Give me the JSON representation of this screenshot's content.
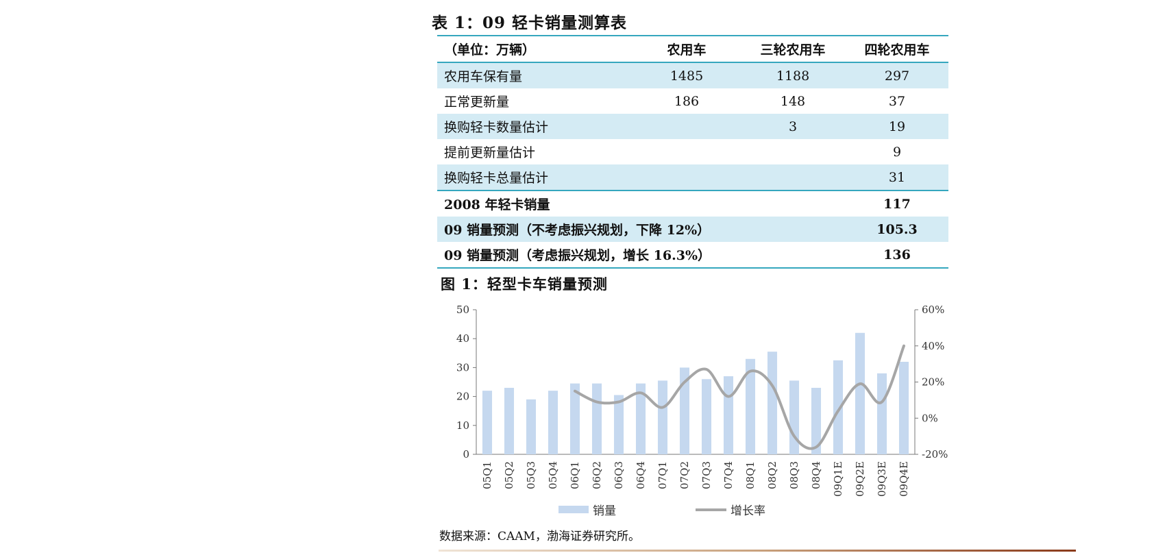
{
  "table": {
    "title": "表 1：09 轻卡销量测算表",
    "header": [
      "（单位：万辆）",
      "农用车",
      "三轮农用车",
      "四轮农用车"
    ],
    "rows": [
      {
        "label": "农用车保有量",
        "cells": [
          "1485",
          "1188",
          "297"
        ]
      },
      {
        "label": "正常更新量",
        "cells": [
          "186",
          "148",
          "37"
        ]
      },
      {
        "label": "换购轻卡数量估计",
        "cells": [
          "",
          "3",
          "19"
        ]
      },
      {
        "label": "提前更新量估计",
        "cells": [
          "",
          "",
          "9"
        ]
      },
      {
        "label": "换购轻卡总量估计",
        "cells": [
          "",
          "",
          "31"
        ]
      },
      {
        "label": "2008 年轻卡销量",
        "cells": [
          "",
          "",
          "117"
        ]
      },
      {
        "label": "09 销量预测（不考虑振兴规划，下降 12%）",
        "cells": [
          "",
          "",
          "105.3"
        ]
      },
      {
        "label": "09 销量预测（考虑振兴规划，增长 16.3%）",
        "cells": [
          "",
          "",
          "136"
        ]
      }
    ]
  },
  "figure": {
    "title": "图 1：轻型卡车销量预测",
    "source": "数据来源：CAAM，渤海证券研究所。"
  },
  "colors": {
    "rule": "#35a7be",
    "row_shade": "#d4ebf4",
    "bar": "#c5d8ef",
    "line": "#a6a6a6",
    "axis": "#777777"
  },
  "chart_data": {
    "type": "bar",
    "title": "",
    "categories": [
      "05Q1",
      "05Q2",
      "05Q3",
      "05Q4",
      "06Q1",
      "06Q2",
      "06Q3",
      "06Q4",
      "07Q1",
      "07Q2",
      "07Q3",
      "07Q4",
      "08Q1",
      "08Q2",
      "08Q3",
      "08Q4",
      "09Q1E",
      "09Q2E",
      "09Q3E",
      "09Q4E"
    ],
    "series": [
      {
        "name": "销量",
        "type": "bar",
        "axis": "left",
        "values": [
          22,
          23,
          19,
          22,
          24.5,
          24.5,
          20.5,
          24.5,
          25.5,
          30,
          26,
          27,
          33,
          35.5,
          25.5,
          23,
          32.5,
          42,
          28,
          32
        ]
      },
      {
        "name": "增长率",
        "type": "line",
        "axis": "right",
        "smooth": true,
        "start_index": 4,
        "values": [
          15,
          9,
          9,
          14,
          6,
          20,
          27,
          12,
          26,
          18,
          -10,
          -16,
          4,
          19,
          9,
          40
        ]
      }
    ],
    "left_axis": {
      "ticks": [
        "0",
        "10",
        "20",
        "30",
        "40",
        "50"
      ],
      "ylim": [
        0,
        50
      ]
    },
    "right_axis": {
      "ticks": [
        "-20%",
        "0%",
        "20%",
        "40%",
        "60%"
      ],
      "ylim": [
        -20,
        60
      ]
    },
    "grid": false,
    "legend": "bottom"
  }
}
